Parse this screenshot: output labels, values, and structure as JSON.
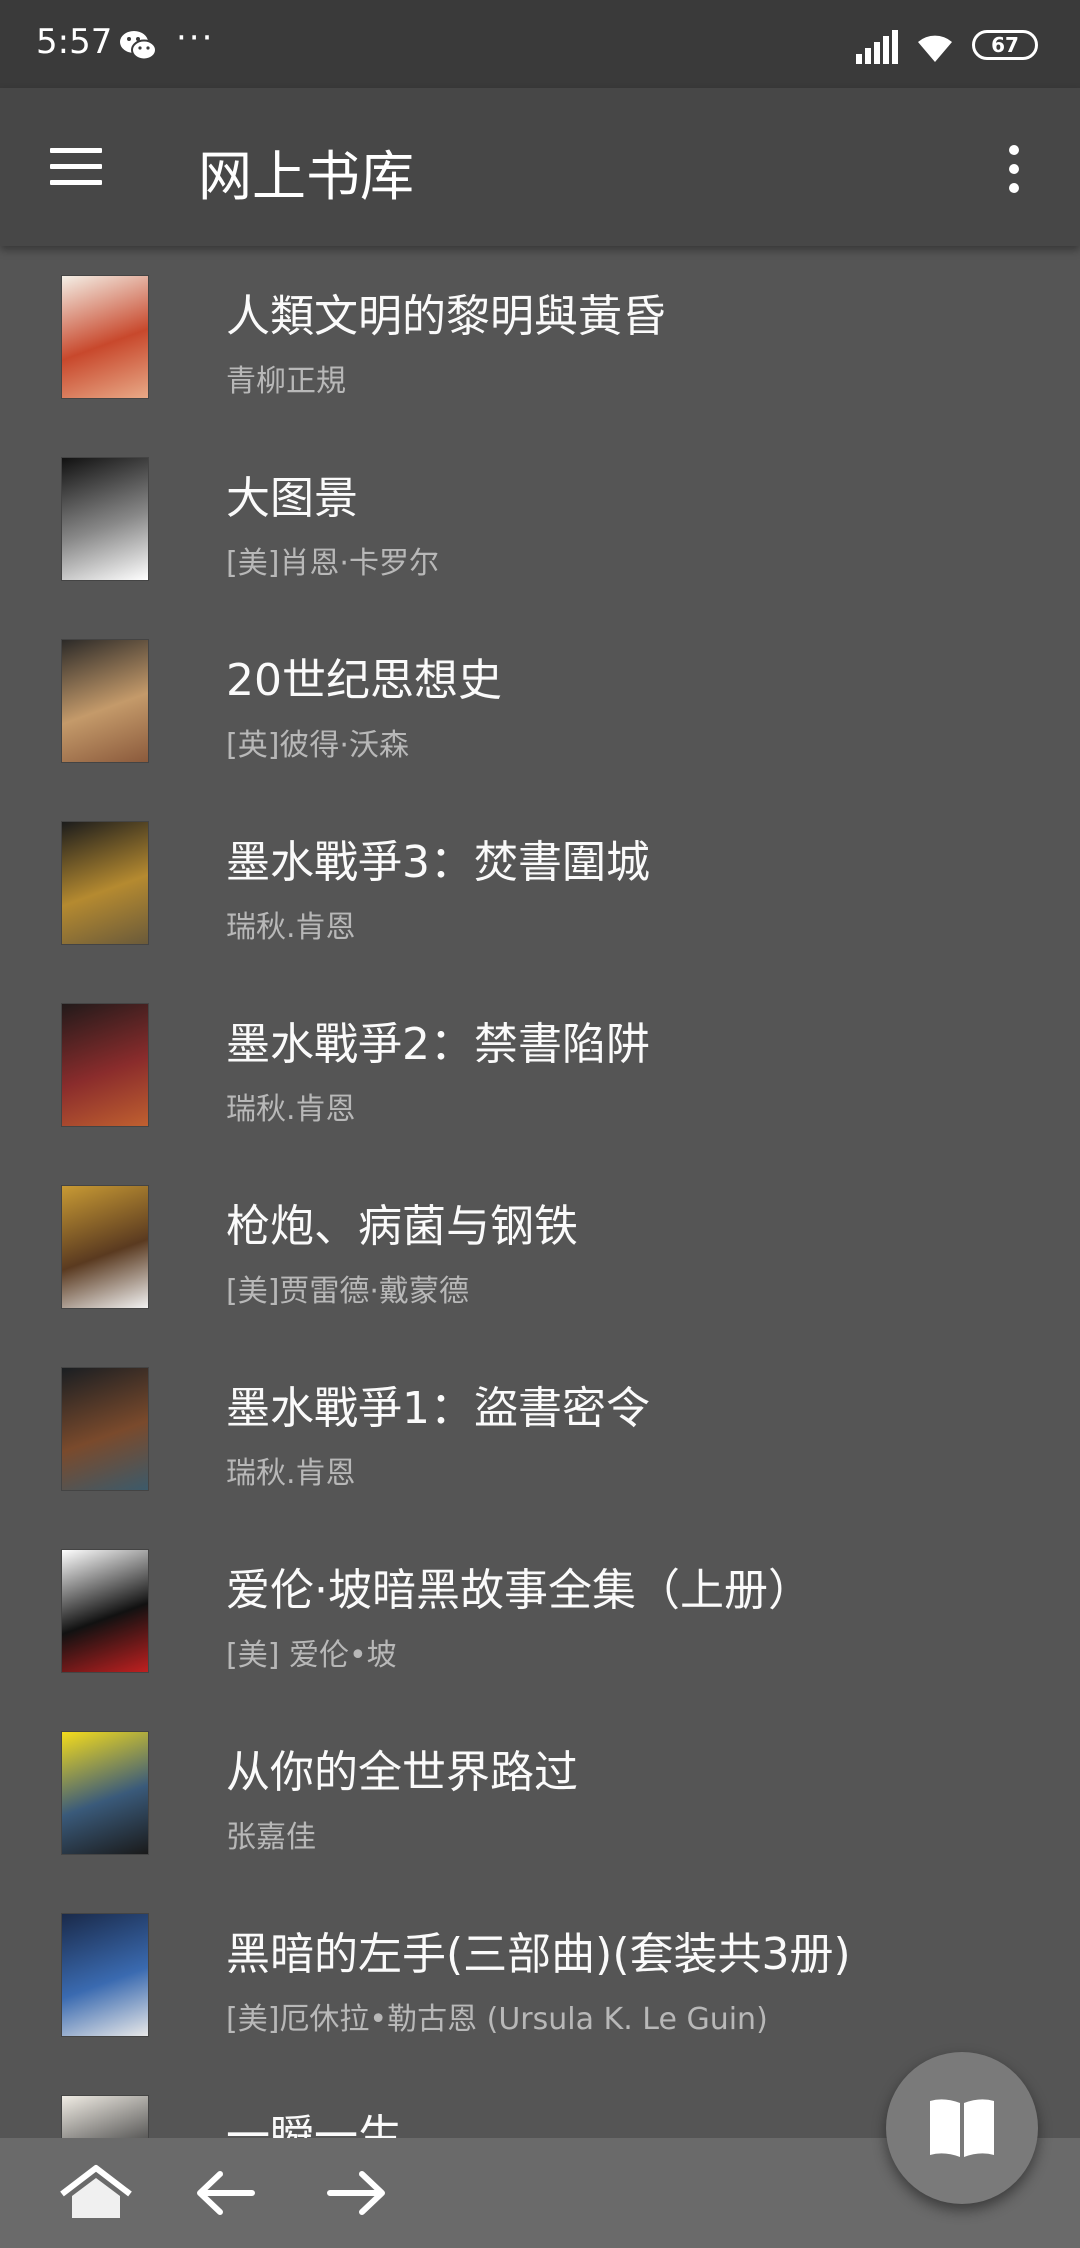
{
  "status_bar": {
    "time": "5:57",
    "dots": "···",
    "battery": "67",
    "icons": [
      "wechat-icon",
      "signal-icon",
      "wifi-icon",
      "battery-icon"
    ]
  },
  "app_bar": {
    "title": "网上书库",
    "menu_icon": "hamburger-menu-icon",
    "more_icon": "more-vertical-icon"
  },
  "books": [
    {
      "title": "人類文明的黎明與黃昏",
      "author": "青柳正規",
      "cover_colors": [
        "#f4efe6",
        "#c8482c",
        "#e8a987"
      ]
    },
    {
      "title": "大图景",
      "author": "[美]肖恩·卡罗尔",
      "cover_colors": [
        "#111111",
        "#888888",
        "#ffffff"
      ]
    },
    {
      "title": "20世纪思想史",
      "author": "[英]彼得·沃森",
      "cover_colors": [
        "#2c2a28",
        "#c49a6a",
        "#8b5a3c"
      ]
    },
    {
      "title": "墨水戰爭3：焚書圍城",
      "author": "瑞秋.肯恩",
      "cover_colors": [
        "#1c1c1c",
        "#b58a30",
        "#6a5a3a"
      ]
    },
    {
      "title": "墨水戰爭2：禁書陷阱",
      "author": "瑞秋.肯恩",
      "cover_colors": [
        "#221a1a",
        "#8a2c2c",
        "#c06030"
      ]
    },
    {
      "title": "枪炮、病菌与钢铁",
      "author": "[美]贾雷德·戴蒙德",
      "cover_colors": [
        "#c89a34",
        "#5a3a20",
        "#f2f2f2"
      ]
    },
    {
      "title": "墨水戰爭1：盜書密令",
      "author": "瑞秋.肯恩",
      "cover_colors": [
        "#1a1e22",
        "#7a4a2c",
        "#3c5a6a"
      ]
    },
    {
      "title": "爱伦·坡暗黑故事全集（上册）",
      "author": "[美] 爱伦•坡",
      "cover_colors": [
        "#ffffff",
        "#111111",
        "#c02020"
      ]
    },
    {
      "title": "从你的全世界路过",
      "author": "张嘉佳",
      "cover_colors": [
        "#f4dc1c",
        "#3a5a7a",
        "#1a1a1a"
      ]
    },
    {
      "title": "黑暗的左手(三部曲)(套装共3册)",
      "author": "[美]厄休拉•勒古恩 (Ursula K. Le Guin)",
      "cover_colors": [
        "#1a2a4a",
        "#3a6ab0",
        "#e8e8e8"
      ]
    },
    {
      "title": "一瞬一生",
      "author": "",
      "cover_colors": [
        "#f0ece4",
        "#444444",
        "#9a9a9a"
      ]
    }
  ],
  "bottom_bar": {
    "icons": [
      "home-icon",
      "back-arrow-icon",
      "forward-arrow-icon"
    ]
  },
  "fab": {
    "icon": "open-book-icon"
  }
}
